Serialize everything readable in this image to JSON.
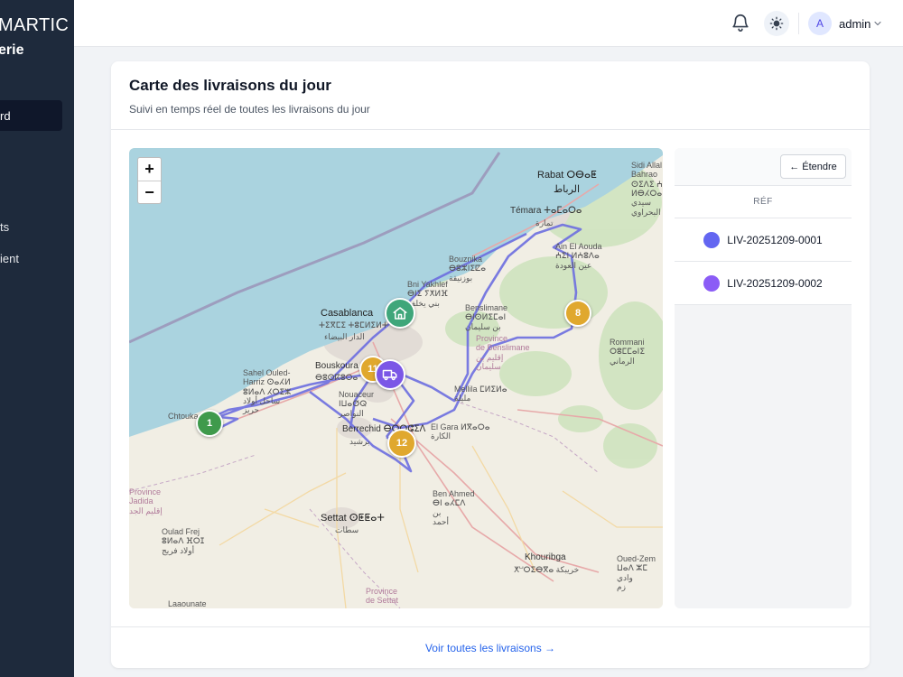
{
  "sidebar": {
    "brand_line1": "MARTIC",
    "brand_line2": "erie",
    "active_item": "rd",
    "items": [
      "ts",
      "ient"
    ]
  },
  "header": {
    "avatar_initial": "A",
    "user_name": "admin"
  },
  "card": {
    "title": "Carte des livraisons du jour",
    "subtitle": "Suivi en temps réel de toutes les livraisons du jour",
    "footer_link": "Voir toutes les livraisons →"
  },
  "map": {
    "zoom_in": "+",
    "zoom_out": "−",
    "labels": {
      "rabat": "Rabat ⵔⴱⴰⵟ",
      "rabat_ar": "الرباط",
      "temara": "Témara ⵜⴰⵎⴰⵔⴰ",
      "temara_ar": "تمارة",
      "sidi_allal": "Sidi Allal\nBahrao\nⵙⵉⴷⵉ ⵄⵍⵍⴰⵍ\nⵍⴱⵃⵔⴰⵡⵉ\nسيدي\nالبحراوي",
      "ain_aouda": "Ain El Aouda\nⵄⵉⵏ ⵍⵄⵓⴷⴰ\nعين العودة",
      "bouznika": "Bouznika\nⴱⵓⵣⵏⵉⵇⴰ\nبوزنيقة",
      "bni_yakhlef": "Bni Yakhlef\nⴱⵏⵉ ⵢⵅⵍⴼ\nبني يخلف",
      "benslimane": "Benslimane\nⴱⵏⵙⵍⵉⵎⴰⵏ\nبن سليمان",
      "prov_benslimane": "Province\nde Benslimane\nإقليم بن\nسليمان",
      "rommani": "Rommani\nⵔⵓⵎⵎⴰⵏⵉ\nالرماني",
      "casablanca": "Casablanca",
      "casablanca_tf": "ⵜⵉⴳⵎⵉ ⵜⵓⵎⵍⵉⵍⵜ",
      "casablanca_ar": "الدار البيضاء",
      "bouskoura": "Bouskoura",
      "bouskoura_tf": "ⴱⵓⵙⴽⵓⵔⴰ",
      "nouaceur": "Nouaceur\nⵏⵡⴰⵚⵕ\nالنواصر",
      "sahel": "Sahel Ouled-\nHarriz ⵙⴰⵃⵍ\nⵓⵍⴰⴷ ⵃⵔⵉⵣ\nساحل أولاد\nحريز",
      "mellila": "Mellila ⵎⵍⵉⵍⴰ\nمليلة",
      "chtouka": "Chtouka",
      "berrechid": "Berrechid ⴱⵔⵔⵛⵉⴷ",
      "berrechid_ar": "برشيد",
      "el_gara": "El Gara ⵍⴳⴰⵔⴰ\nالكارة",
      "ben_ahmed": "Ben Ahmed\nⴱⵏ ⴰⵃⵎⴷ\nبن\nأحمد",
      "prov_jadida": "Province\nJadida\nإقليم الجد",
      "settat": "Settat ⵙⵟⵟⴰⵜ",
      "settat_ar": "سطات",
      "ouled_frej": "Oulad Frej\nⵓⵍⴰⴷ ⴼⵔⵊ\nأولاد فريج",
      "khouribga": "Khouribga",
      "khouribga_tf": "ⵅⵯⵔⵉⴱⴳⴰ خريبكة",
      "oued_zem": "Oued-Zem\nⵡⴰⴷ ⵣⵎ\nوادي\nزم",
      "prov_settat": "Province\nde Settat",
      "laaounate": "Laaounate"
    },
    "markers": [
      {
        "name": "cluster-1",
        "label": "1",
        "color": "#3f9a4c"
      },
      {
        "name": "cluster-8",
        "label": "8",
        "color": "#e0a82e"
      },
      {
        "name": "cluster-11",
        "label": "11",
        "color": "#e0a82e"
      },
      {
        "name": "cluster-12",
        "label": "12",
        "color": "#e0a82e"
      },
      {
        "name": "depot-marker",
        "label": "",
        "color": "#3fa67a"
      },
      {
        "name": "vehicle-marker",
        "label": "",
        "color": "#7b57e6"
      }
    ],
    "route_color": "#6d6ee0"
  },
  "panel": {
    "expand_label": "← Étendre",
    "column_header": "RÉF",
    "rows": [
      {
        "ref": "LIV-20251209-0001",
        "color": "#6366f1"
      },
      {
        "ref": "LIV-20251209-0002",
        "color": "#8b5cf6"
      }
    ]
  }
}
